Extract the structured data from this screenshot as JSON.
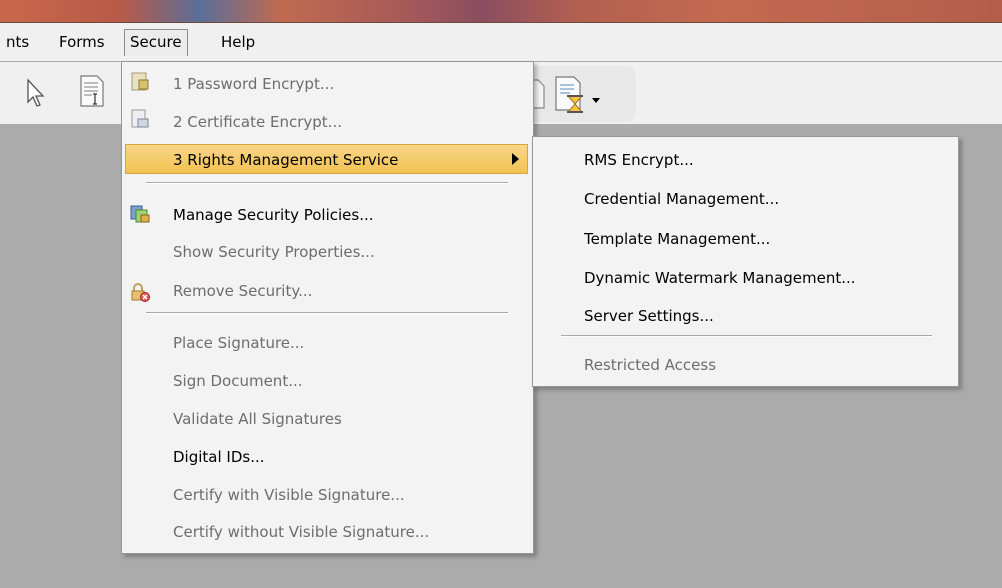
{
  "menubar": {
    "items": [
      {
        "label": "nts"
      },
      {
        "label": "Forms"
      },
      {
        "label": "Secure"
      },
      {
        "label": "Help"
      }
    ]
  },
  "secure_menu": {
    "items": [
      {
        "label": "1 Password Encrypt...",
        "enabled": false,
        "icon": "password-doc-icon"
      },
      {
        "label": "2 Certificate Encrypt...",
        "enabled": false,
        "icon": "certificate-doc-icon"
      },
      {
        "label": "3 Rights Management Service",
        "enabled": true,
        "highlighted": true,
        "has_submenu": true
      },
      {
        "label": "Manage Security Policies...",
        "enabled": true,
        "icon": "security-policies-icon"
      },
      {
        "label": "Show Security Properties...",
        "enabled": false
      },
      {
        "label": "Remove Security...",
        "enabled": false,
        "icon": "remove-security-icon"
      },
      {
        "label": "Place Signature...",
        "enabled": false
      },
      {
        "label": "Sign Document...",
        "enabled": false
      },
      {
        "label": "Validate All Signatures",
        "enabled": false
      },
      {
        "label": "Digital IDs...",
        "enabled": true
      },
      {
        "label": "Certify with Visible Signature...",
        "enabled": false
      },
      {
        "label": "Certify without Visible Signature...",
        "enabled": false
      }
    ]
  },
  "rms_submenu": {
    "items": [
      {
        "label": "RMS Encrypt...",
        "enabled": true
      },
      {
        "label": "Credential Management...",
        "enabled": true
      },
      {
        "label": "Template Management...",
        "enabled": true
      },
      {
        "label": "Dynamic Watermark Management...",
        "enabled": true
      },
      {
        "label": "Server Settings...",
        "enabled": true
      },
      {
        "label": "Restricted Access",
        "enabled": false
      }
    ]
  },
  "colors": {
    "menu_bg": "#f3f3f3",
    "highlight": "#f2c251",
    "disabled_text": "#6d6d6d",
    "workspace": "#ababab"
  }
}
